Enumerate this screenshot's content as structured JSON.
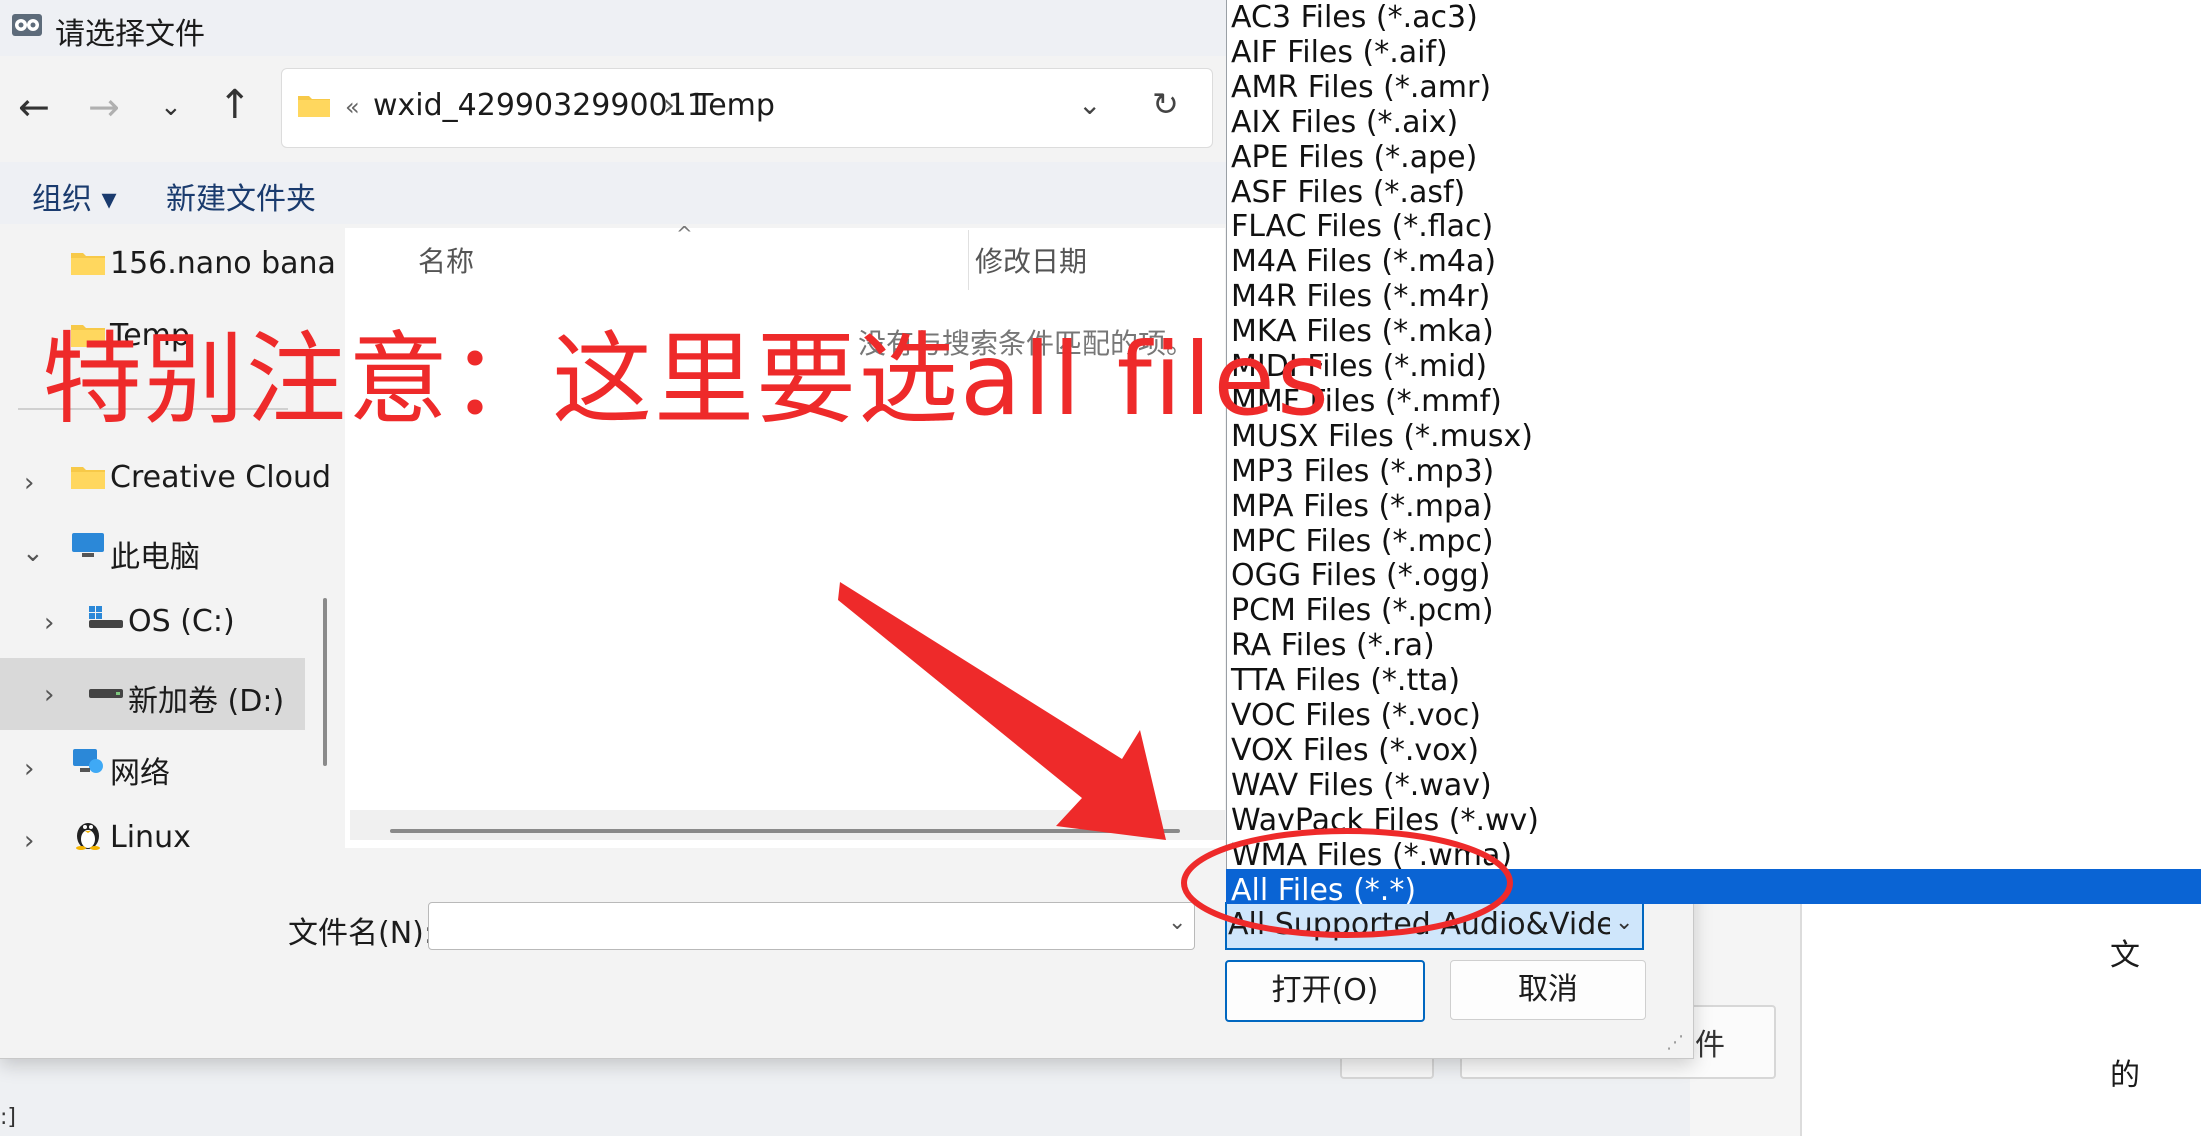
{
  "dialog": {
    "title": "请选择文件",
    "breadcrumb": {
      "overflow": "«",
      "items": [
        "wxid_4299032990011",
        "Temp"
      ],
      "separator": "›"
    },
    "toolbar": {
      "organize": "组织 ▾",
      "new_folder": "新建文件夹"
    },
    "sidebar": {
      "items": [
        {
          "label": "156.nano bana"
        },
        {
          "label": "Temp"
        },
        {
          "label": "Creative Cloud"
        },
        {
          "label": "此电脑"
        },
        {
          "label": "OS (C:)"
        },
        {
          "label": "新加卷 (D:)"
        },
        {
          "label": "网络"
        },
        {
          "label": "Linux"
        }
      ]
    },
    "columns": {
      "name": "名称",
      "date": "修改日期"
    },
    "empty_message": "没有与搜索条件匹配的项。",
    "filename_label": "文件名(N):",
    "filename_value": "",
    "filetype_selected": "All Supported Audio&Video F",
    "open_button": "打开(O)",
    "cancel_button": "取消"
  },
  "filetype_options": [
    "AC3 Files (*.ac3)",
    "AIF Files (*.aif)",
    "AMR Files (*.amr)",
    "AIX Files (*.aix)",
    "APE Files (*.ape)",
    "ASF Files (*.asf)",
    "FLAC Files (*.flac)",
    "M4A Files (*.m4a)",
    "M4R Files (*.m4r)",
    "MKA Files (*.mka)",
    "MIDI Files (*.mid)",
    "MMF Files (*.mmf)",
    "MUSX Files (*.musx)",
    "MP3 Files (*.mp3)",
    "MPA Files (*.mpa)",
    "MPC Files (*.mpc)",
    "OGG Files (*.ogg)",
    "PCM Files (*.pcm)",
    "RA Files (*.ra)",
    "TTA Files (*.tta)",
    "VOC Files (*.voc)",
    "VOX Files (*.vox)",
    "WAV Files (*.wav)",
    "WavPack Files (*.wv)",
    "WMA Files (*.wma)",
    "All Files (*.*)"
  ],
  "selected_option": "All Files (*.*)",
  "annotation": {
    "text": "特别注意：这里要选all files",
    "color": "#ee2a2a"
  },
  "background": {
    "char_1": "文",
    "char_2": "的",
    "button_text": "件",
    "corner_text": ":]"
  },
  "colors": {
    "accent": "#0067c0",
    "selection": "#0a64d4"
  }
}
